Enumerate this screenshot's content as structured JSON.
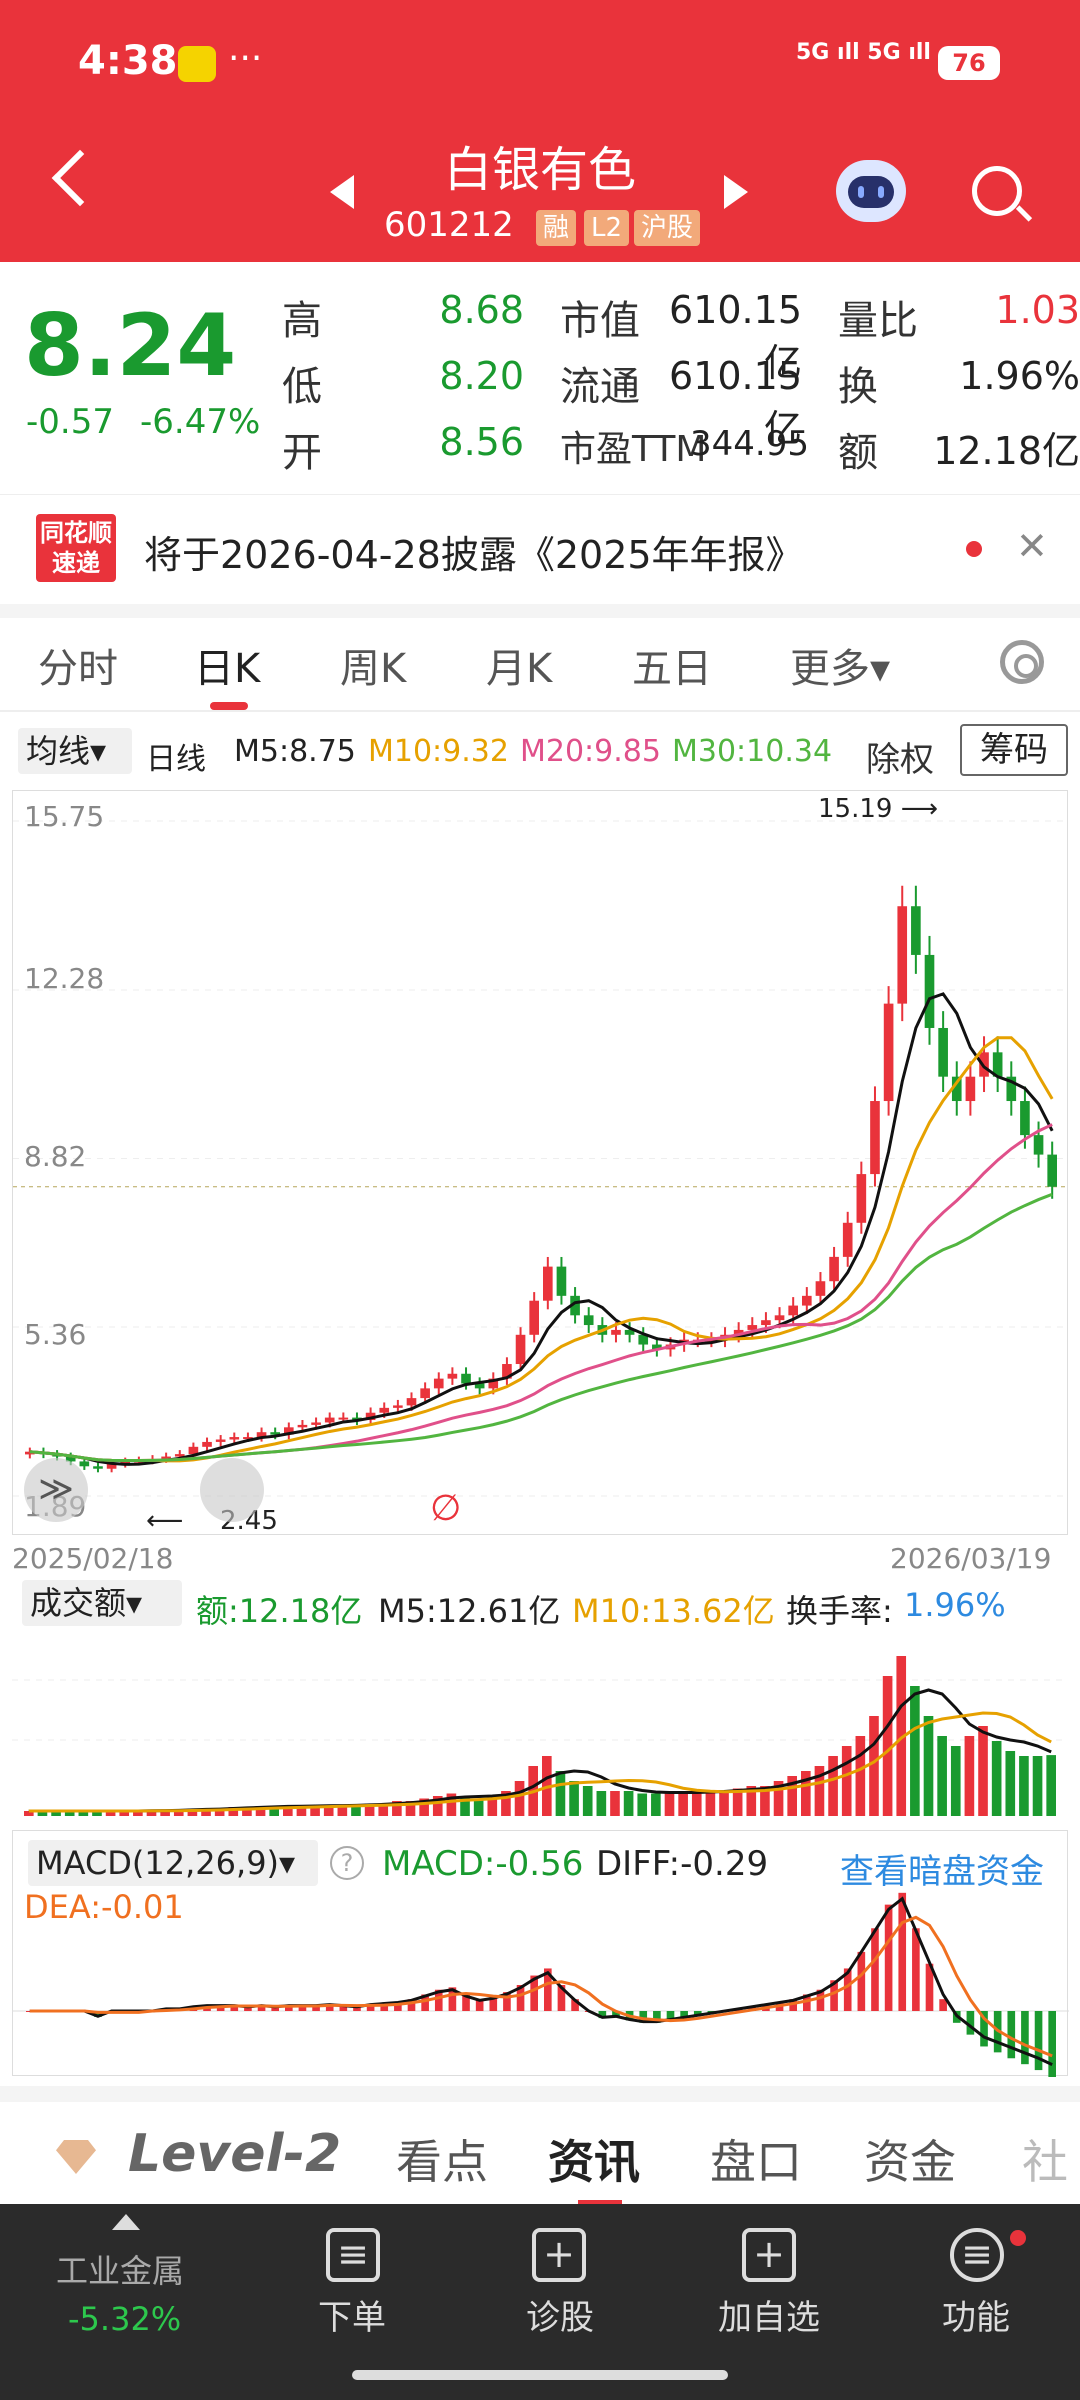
{
  "status": {
    "time": "4:38",
    "dots": "···",
    "signal": "5G ıll 5G ıll",
    "battery": "76"
  },
  "header": {
    "name": "白银有色",
    "code": "601212",
    "tags": [
      "融",
      "L2",
      "沪股"
    ]
  },
  "quote": {
    "price": "8.24",
    "change": "-0.57",
    "change_pct": "-6.47%",
    "high_label": "高",
    "high": "8.68",
    "low_label": "低",
    "low": "8.20",
    "open_label": "开",
    "open": "8.56",
    "mcap_label": "市值",
    "mcap": "610.15亿",
    "float_label": "流通",
    "float": "610.15亿",
    "pe_label": "市盈TTM",
    "pe": "344.95",
    "vr_label": "量比",
    "vr": "1.03",
    "turn_label": "换",
    "turn": "1.96%",
    "amt_label": "额",
    "amt": "12.18亿"
  },
  "notice": {
    "logo_top": "同花顺",
    "logo_bottom": "速递",
    "text": "将于2026-04-28披露《2025年年报》",
    "close": "✕"
  },
  "tabs": [
    "分时",
    "日K",
    "周K",
    "月K",
    "五日",
    "更多▾"
  ],
  "ma_bar": {
    "select": "均线▾",
    "period": "日线",
    "m5": "M5:8.75",
    "m10": "M10:9.32",
    "m20": "M20:9.85",
    "m30": "M30:10.34",
    "fuquan": "除权",
    "chips": "筹码"
  },
  "kline": {
    "yticks": [
      "15.75",
      "12.28",
      "8.82",
      "5.36",
      "1.89"
    ],
    "start_date": "2025/02/18",
    "end_date": "2026/03/19",
    "high_marker": "15.19",
    "low_marker": "2.45",
    "expand": "≫",
    "ex_mark": "∅"
  },
  "volume": {
    "select": "成交额▾",
    "amt": "额:12.18亿",
    "m5": "M5:12.61亿",
    "m10": "M10:13.62亿",
    "turn_label": "换手率:",
    "turn": "1.96%"
  },
  "macd": {
    "select": "MACD(12,26,9)▾",
    "help": "?",
    "macd": "MACD:-0.56",
    "diff": "DIFF:-0.29",
    "dea": "DEA:-0.01",
    "link": "查看暗盘资金"
  },
  "news_tabs": {
    "level2": "Level-2",
    "items": [
      "看点",
      "资讯",
      "盘口",
      "资金",
      "社"
    ]
  },
  "bottom": {
    "sector_name": "工业金属",
    "sector_change": "-5.32%",
    "buttons": [
      "下单",
      "诊股",
      "加自选",
      "功能"
    ]
  },
  "colors": {
    "red": "#e9333b",
    "green": "#1a9a2f",
    "m10": "#e6a100",
    "m20": "#e0508a",
    "m30": "#52b540",
    "blue": "#2d8ae0"
  },
  "chart_data": {
    "type": "candlestick",
    "title": "日K",
    "ylim": [
      1.89,
      15.75
    ],
    "yticks": [
      15.75,
      12.28,
      8.82,
      5.36,
      1.89
    ],
    "x_start": "2025/02/18",
    "x_end": "2026/03/19",
    "close": [
      2.8,
      2.75,
      2.7,
      2.6,
      2.5,
      2.45,
      2.55,
      2.6,
      2.62,
      2.65,
      2.7,
      2.75,
      2.9,
      3.0,
      3.05,
      3.1,
      3.1,
      3.2,
      3.15,
      3.3,
      3.35,
      3.4,
      3.5,
      3.5,
      3.45,
      3.6,
      3.7,
      3.75,
      3.9,
      4.1,
      4.3,
      4.4,
      4.2,
      4.1,
      4.3,
      4.6,
      5.2,
      5.9,
      6.6,
      6.0,
      5.6,
      5.4,
      5.2,
      5.3,
      5.2,
      5.0,
      4.9,
      5.0,
      5.1,
      5.1,
      5.1,
      5.2,
      5.3,
      5.4,
      5.5,
      5.6,
      5.8,
      6.0,
      6.3,
      6.8,
      7.5,
      8.5,
      10.0,
      12.0,
      14.0,
      13.0,
      11.5,
      10.5,
      10.0,
      10.5,
      11.0,
      10.5,
      10.0,
      9.3,
      8.9,
      8.24
    ],
    "ma_lines": [
      "M5",
      "M10",
      "M20",
      "M30"
    ],
    "volume_amount": [
      1,
      1,
      1,
      1,
      1,
      1,
      1,
      1,
      1,
      1.2,
      1.2,
      1.2,
      1.5,
      1.5,
      1.5,
      1.8,
      1.8,
      2,
      2,
      2,
      2,
      2,
      2.2,
      2.2,
      2.2,
      2.5,
      2.5,
      3,
      3,
      3.5,
      4,
      4.5,
      4,
      3.5,
      4,
      5,
      7,
      10,
      12,
      9,
      7,
      6,
      5,
      5,
      5,
      4.5,
      4.5,
      4.5,
      5,
      5,
      5,
      5,
      5.5,
      6,
      6,
      7,
      8,
      9,
      10,
      12,
      14,
      16,
      20,
      28,
      32,
      26,
      20,
      16,
      14,
      16,
      18,
      15,
      13,
      12,
      12,
      12.18
    ],
    "macd_hist": [
      0,
      0,
      0,
      0,
      0,
      -0.05,
      0,
      0,
      0,
      0,
      0.02,
      0.02,
      0.04,
      0.05,
      0.05,
      0.05,
      0.04,
      0.05,
      0.04,
      0.05,
      0.05,
      0.05,
      0.06,
      0.05,
      0.04,
      0.06,
      0.07,
      0.08,
      0.1,
      0.14,
      0.18,
      0.2,
      0.14,
      0.1,
      0.12,
      0.16,
      0.22,
      0.3,
      0.36,
      0.22,
      0.1,
      0,
      -0.06,
      -0.05,
      -0.08,
      -0.1,
      -0.1,
      -0.08,
      -0.06,
      -0.04,
      -0.02,
      0,
      0.02,
      0.04,
      0.06,
      0.08,
      0.1,
      0.14,
      0.18,
      0.26,
      0.36,
      0.5,
      0.7,
      0.9,
      1.0,
      0.7,
      0.4,
      0.1,
      -0.1,
      -0.2,
      -0.3,
      -0.35,
      -0.4,
      -0.45,
      -0.5,
      -0.56
    ]
  }
}
